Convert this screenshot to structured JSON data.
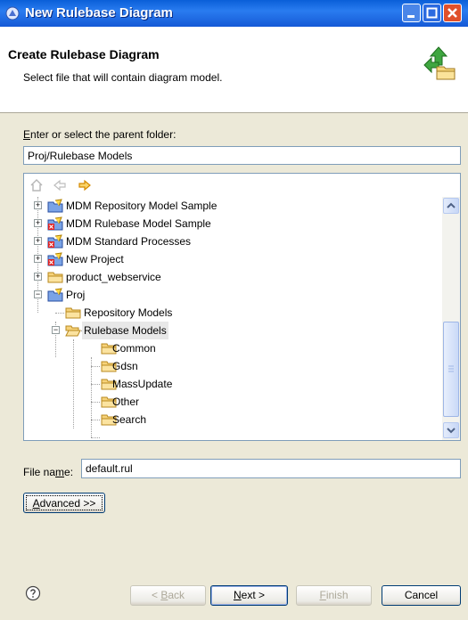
{
  "window": {
    "title": "New Rulebase Diagram"
  },
  "header": {
    "title": "Create Rulebase Diagram",
    "description": "Select file that will contain diagram model."
  },
  "folder": {
    "label_prefix": "E",
    "label_rest": "nter or select the parent folder:",
    "value": "Proj/Rulebase Models"
  },
  "tree": {
    "items": [
      {
        "label": "MDM Repository Model Sample",
        "icon": "project-icon"
      },
      {
        "label": "MDM Rulebase Model Sample",
        "icon": "project-error-icon"
      },
      {
        "label": "MDM Standard Processes",
        "icon": "project-error-icon"
      },
      {
        "label": "New Project",
        "icon": "project-error-icon"
      },
      {
        "label": "product_webservice",
        "icon": "folder-icon"
      },
      {
        "label": "Proj",
        "icon": "project-icon"
      },
      {
        "label": "Repository Models",
        "icon": "folder-icon"
      },
      {
        "label": "Rulebase Models",
        "icon": "folder-open-icon",
        "selected": true
      },
      {
        "label": "Common",
        "icon": "folder-icon"
      },
      {
        "label": "Gdsn",
        "icon": "folder-icon"
      },
      {
        "label": "MassUpdate",
        "icon": "folder-icon"
      },
      {
        "label": "Other",
        "icon": "folder-icon"
      },
      {
        "label": "Search",
        "icon": "folder-icon"
      }
    ]
  },
  "file": {
    "label_prefix": "File na",
    "label_mnemonic": "m",
    "label_suffix": "e:",
    "value": "default.rul"
  },
  "buttons": {
    "advanced_m": "A",
    "advanced_rest": "dvanced >>",
    "back_pre": "< ",
    "back_m": "B",
    "back_rest": "ack",
    "next_m": "N",
    "next_rest": "ext >",
    "finish_m": "F",
    "finish_rest": "inish",
    "cancel": "Cancel"
  },
  "colors": {
    "titlebar": "#0a5fd8",
    "dialog_bg": "#ece9d8",
    "selection": "#e8e8e8"
  }
}
